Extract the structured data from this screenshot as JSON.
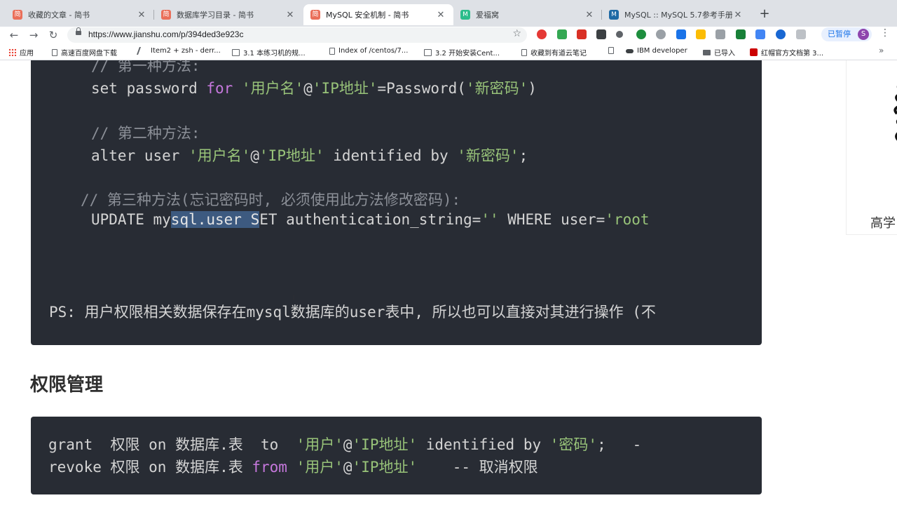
{
  "tabs": [
    {
      "title": "收藏的文章 - 简书",
      "favicon": "简",
      "color": "#ea6f5a"
    },
    {
      "title": "数据库学习目录 - 简书",
      "favicon": "简",
      "color": "#ea6f5a"
    },
    {
      "title": "MySQL 安全机制 - 简书",
      "favicon": "简",
      "color": "#ea6f5a",
      "active": true
    },
    {
      "title": "爱福窝",
      "favicon": "M",
      "color": "#2bbd8b"
    },
    {
      "title": "MySQL :: MySQL 5.7参考手册:",
      "favicon": "M",
      "color": "#1f6aa5"
    }
  ],
  "toolbar": {
    "url": "https://www.jianshu.com/p/394ded3e923c",
    "paused_label": "已暂停",
    "avatar_letter": "S"
  },
  "bookmarks": [
    {
      "label": "应用",
      "icon": "grid-icon"
    },
    {
      "label": "高速百度网盘下载",
      "icon": "page-icon"
    },
    {
      "label": "Item2 + zsh - derr...",
      "icon": "page-icon"
    },
    {
      "label": "3.1 本练习机的规...",
      "icon": "book-icon"
    },
    {
      "label": "Index of /centos/7...",
      "icon": "page-icon"
    },
    {
      "label": "3.2 开始安装Cent...",
      "icon": "book-icon"
    },
    {
      "label": "收藏到有道云笔记",
      "icon": "page-icon"
    },
    {
      "label": "",
      "icon": "page-icon"
    },
    {
      "label": "IBM developer",
      "icon": "ibm-icon"
    },
    {
      "label": "已导入",
      "icon": "folder-icon"
    },
    {
      "label": "红帽官方文档第 3...",
      "icon": "redhat-icon"
    }
  ],
  "code_block_1": {
    "comment1": "// 第一种方法:",
    "line1_a": "set password ",
    "line1_kw": "for",
    "line1_s1": " '用户名'",
    "line1_at": "@",
    "line1_s2": "'IP地址'",
    "line1_b": "=Password(",
    "line1_s3": "'新密码'",
    "line1_c": ")",
    "comment2": "// 第二种方法:",
    "line2_a": "alter user ",
    "line2_s1": "'用户名'",
    "line2_at": "@",
    "line2_s2": "'IP地址'",
    "line2_b": " identified by ",
    "line2_s3": "'新密码'",
    "line2_c": ";",
    "comment3": "// 第三种方法(忘记密码时, 必须使用此方法修改密码):",
    "line3_a": "UPDATE my",
    "line3_sel": "sql.user S",
    "line3_b": "ET authentication_string=",
    "line3_s1": "''",
    "line3_c": " WHERE user=",
    "line3_s2": "'root",
    "ps": "PS: 用户权限相关数据保存在mysql数据库的user表中, 所以也可以直接对其进行操作 (不"
  },
  "section_title": "权限管理",
  "code_block_2": {
    "g_a": "grant  权限 on 数据库.表  to  ",
    "g_s1": "'用户'",
    "g_at": "@",
    "g_s2": "'IP地址'",
    "g_b": " identified by ",
    "g_s3": "'密码'",
    "g_c": ";   -",
    "r_a": "revoke 权限 on 数据库.表 ",
    "r_kw": "from",
    "r_sp": " ",
    "r_s1": "'用户'",
    "r_at": "@",
    "r_s2": "'IP地址'",
    "r_c": "    -- 取消权限"
  },
  "side": {
    "text": "高学"
  }
}
